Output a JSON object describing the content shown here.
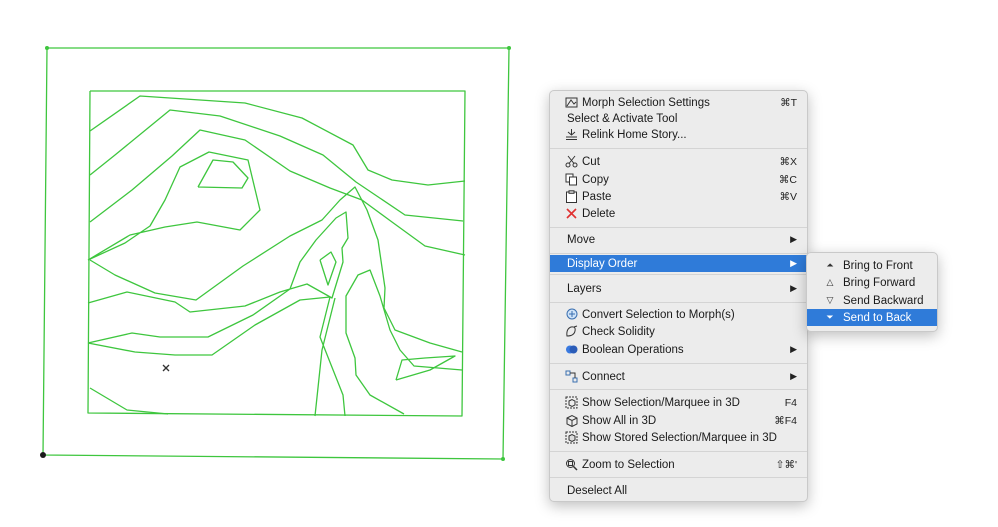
{
  "canvas": {
    "line_color": "#3ec63e",
    "origin_marker": "x-marker"
  },
  "context_menu": {
    "highlight_color": "#2f7bd9",
    "items": [
      {
        "label": "Morph Selection Settings",
        "icon": "morph-settings-icon",
        "shortcut": "⌘T"
      },
      {
        "label": "Select & Activate Tool",
        "icon": "",
        "shortcut": ""
      },
      {
        "label": "Relink Home Story...",
        "icon": "relink-story-icon",
        "shortcut": ""
      },
      {
        "label": "Cut",
        "icon": "scissors-icon",
        "shortcut": "⌘X"
      },
      {
        "label": "Copy",
        "icon": "copy-icon",
        "shortcut": "⌘C"
      },
      {
        "label": "Paste",
        "icon": "clipboard-icon",
        "shortcut": "⌘V"
      },
      {
        "label": "Delete",
        "icon": "delete-x-icon",
        "shortcut": ""
      },
      {
        "label": "Move",
        "submenu": true
      },
      {
        "label": "Display Order",
        "submenu": true,
        "highlighted": true
      },
      {
        "label": "Layers",
        "submenu": true
      },
      {
        "label": "Convert Selection to Morph(s)",
        "icon": "convert-morph-icon"
      },
      {
        "label": "Check Solidity",
        "icon": "check-solidity-icon"
      },
      {
        "label": "Boolean Operations",
        "icon": "boolean-icon",
        "submenu": true
      },
      {
        "label": "Connect",
        "icon": "connect-icon",
        "submenu": true
      },
      {
        "label": "Show Selection/Marquee in 3D",
        "icon": "show-3d-icon",
        "shortcut": "F4"
      },
      {
        "label": "Show All in 3D",
        "icon": "show-all-3d-icon",
        "shortcut": "⌘F4"
      },
      {
        "label": "Show Stored Selection/Marquee in 3D",
        "icon": "stored-3d-icon",
        "shortcut": ""
      },
      {
        "label": "Zoom to Selection",
        "icon": "zoom-icon",
        "shortcut": "⇧⌘'"
      },
      {
        "label": "Deselect All"
      }
    ]
  },
  "submenu": {
    "items": [
      {
        "label": "Bring to Front",
        "icon": "bring-to-front-icon"
      },
      {
        "label": "Bring Forward",
        "icon": "bring-forward-icon"
      },
      {
        "label": "Send Backward",
        "icon": "send-backward-icon"
      },
      {
        "label": "Send to Back",
        "icon": "send-to-back-icon",
        "highlighted": true
      }
    ]
  }
}
